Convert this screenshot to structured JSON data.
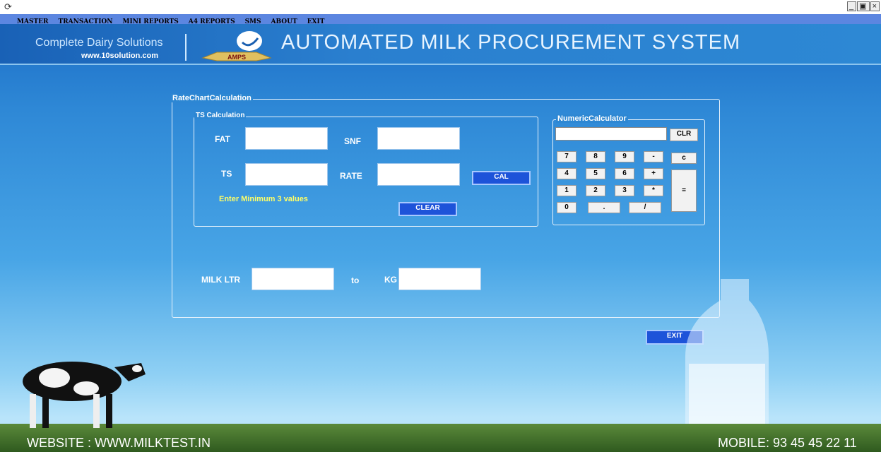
{
  "window": {
    "icon": "app-icon",
    "controls": [
      "_",
      "▫",
      "×"
    ]
  },
  "menu": [
    "MASTER",
    "TRANSACTION",
    "MINI REPORTS",
    "A4 REPORTS",
    "SMS",
    "ABOUT",
    "EXIT"
  ],
  "header": {
    "brand_tagline": "Complete Dairy Solutions",
    "brand_site": "www.10solution.com",
    "logo_text": "AMPS",
    "title": "AUTOMATED MILK PROCUREMENT SYSTEM"
  },
  "rate_chart": {
    "legend": "RateChartCalculation",
    "ts_calc": {
      "legend": "TS Calculation",
      "fat_label": "FAT",
      "snf_label": "SNF",
      "ts_label": "TS",
      "rate_label": "RATE",
      "fat_value": "",
      "snf_value": "",
      "ts_value": "",
      "rate_value": "",
      "cal_button": "CAL",
      "clear_button": "CLEAR",
      "hint": "Enter Minimum 3 values"
    },
    "conversion": {
      "milk_ltr_label": "MILK LTR",
      "to_label": "to",
      "kg_label": "KG",
      "milk_ltr_value": "",
      "kg_value": ""
    }
  },
  "calculator": {
    "legend": "NumericCalculator",
    "display_value": "",
    "clr_button": "CLR",
    "keys": [
      "7",
      "8",
      "9",
      "-",
      "c",
      "4",
      "5",
      "6",
      "+",
      "1",
      "2",
      "3",
      "*",
      "0",
      ".",
      "/",
      "="
    ]
  },
  "exit_button": "EXIT",
  "footer": {
    "website": "WEBSITE : WWW.MILKTEST.IN",
    "mobile": "MOBILE: 93 45 45 22 11"
  },
  "colors": {
    "menubar": "#5c86e0",
    "button_blue": "#1d53d9",
    "hint": "#ffff66"
  }
}
